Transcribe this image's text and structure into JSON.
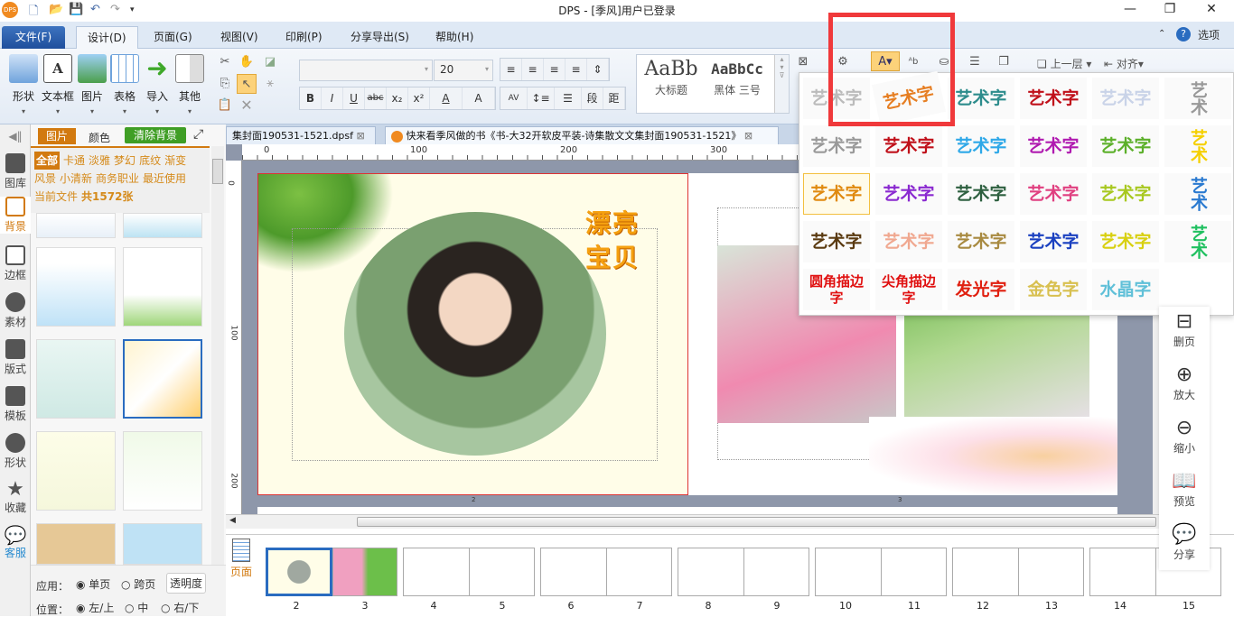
{
  "window": {
    "title": "DPS - [季风]用户已登录",
    "minimize": "—",
    "restore": "❐",
    "close": "✕"
  },
  "quick_access": [
    "new-file",
    "open-folder",
    "save",
    "undo",
    "redo",
    "customize"
  ],
  "menu": {
    "tabs": [
      "文件(F)",
      "设计(D)",
      "页面(G)",
      "视图(V)",
      "印刷(P)",
      "分享导出(S)",
      "帮助(H)"
    ],
    "active": "设计(D)",
    "options": "选项"
  },
  "ribbon": {
    "big_buttons": [
      "形状",
      "文本框",
      "图片",
      "表格",
      "导入",
      "其他"
    ],
    "font_size": "20",
    "format": [
      "B",
      "I",
      "U",
      "abc",
      "x₂",
      "x²",
      "A",
      "A"
    ],
    "align": [
      "≡",
      "≡",
      "≡",
      "≡",
      "⇕"
    ],
    "para": [
      "AV",
      "↕≡",
      "☰",
      "段",
      "距"
    ],
    "styles": [
      {
        "sample": "AaBb",
        "label": "大标题"
      },
      {
        "sample": "AaBbCc",
        "label": "黑体 三号"
      }
    ],
    "arrange": {
      "bring_forward": "上一层",
      "align": "对齐"
    }
  },
  "left_nav": [
    "图库",
    "背景",
    "边框",
    "素材",
    "版式",
    "模板",
    "形状",
    "收藏",
    "客服"
  ],
  "left_nav_active": "背景",
  "panel": {
    "tabs": [
      "图片",
      "颜色"
    ],
    "clear_bg": "清除背景",
    "categories": [
      "全部",
      "卡通",
      "淡雅",
      "梦幻",
      "底纹",
      "渐变",
      "风景",
      "小清新",
      "商务职业",
      "最近使用"
    ],
    "current_file": "当前文件",
    "count": "共1572张",
    "apply_label": "应用：",
    "apply_options": [
      "单页",
      "跨页"
    ],
    "opacity": "透明度",
    "position_label": "位置：",
    "position_options": [
      "左/上",
      "中",
      "右/下"
    ]
  },
  "doc_tabs": [
    {
      "title": "集封面190531-1521.dpsf"
    },
    {
      "title": "快来看季风做的书《书-大32开软皮平装-诗集散文文集封面190531-1521》"
    }
  ],
  "ruler": {
    "h": [
      "0",
      "100",
      "200",
      "300"
    ],
    "v": [
      "0",
      "100",
      "200"
    ]
  },
  "page": {
    "title_chars": [
      "漂",
      "亮",
      "宝",
      "贝"
    ],
    "page_nums": [
      "2",
      "3"
    ]
  },
  "thumbnails": {
    "side_tab": "页面",
    "pages": [
      "2",
      "3",
      "4",
      "5",
      "6",
      "7",
      "8",
      "9",
      "10",
      "11",
      "12",
      "13",
      "14",
      "15"
    ]
  },
  "art_text": {
    "items": [
      {
        "t": "艺术字",
        "c": "#bbb"
      },
      {
        "t": "艺术字",
        "c": "#e67e22"
      },
      {
        "t": "艺术字",
        "c": "#2d8c8c"
      },
      {
        "t": "艺术字",
        "c": "#c0101a"
      },
      {
        "t": "艺术字",
        "c": "#c9d3e8"
      },
      {
        "t": "艺术",
        "c": "#999"
      },
      {
        "t": "艺术字",
        "c": "#999"
      },
      {
        "t": "艺术字",
        "c": "#c0101a"
      },
      {
        "t": "艺术字",
        "c": "#2ea8e8"
      },
      {
        "t": "艺术字",
        "c": "#b01ab0"
      },
      {
        "t": "艺术字",
        "c": "#5cb02a"
      },
      {
        "t": "艺术",
        "c": "#f5d000"
      },
      {
        "t": "艺术字",
        "c": "#e08a10"
      },
      {
        "t": "艺术字",
        "c": "#8a2ad0"
      },
      {
        "t": "艺术字",
        "c": "#2e6040"
      },
      {
        "t": "艺术字",
        "c": "#e04080"
      },
      {
        "t": "艺术字",
        "c": "#a8c820"
      },
      {
        "t": "艺术",
        "c": "#2a7ad0"
      },
      {
        "t": "艺术字",
        "c": "#5a3a10"
      },
      {
        "t": "艺术字",
        "c": "#f0a890"
      },
      {
        "t": "艺术字",
        "c": "#a88a40"
      },
      {
        "t": "艺术字",
        "c": "#1a40c0"
      },
      {
        "t": "艺术字",
        "c": "#d8d010"
      },
      {
        "t": "艺术",
        "c": "#20c060"
      },
      {
        "t": "圆角描边字",
        "c": "#e01010"
      },
      {
        "t": "尖角描边字",
        "c": "#e01010"
      },
      {
        "t": "发光字",
        "c": "#e02010"
      },
      {
        "t": "金色字",
        "c": "#d8c050"
      },
      {
        "t": "水晶字",
        "c": "#60c0d8"
      }
    ],
    "selected": 12
  },
  "right_tools": [
    {
      "icon": "⊟",
      "label": "删页"
    },
    {
      "icon": "⊕",
      "label": "放大"
    },
    {
      "icon": "⊖",
      "label": "缩小"
    },
    {
      "icon": "📖",
      "label": "预览"
    },
    {
      "icon": "💬",
      "label": "分享"
    }
  ],
  "colors": {
    "accent": "#d27a10",
    "highlight": "#f0393b",
    "menu_bg": "#dfe9f5"
  }
}
